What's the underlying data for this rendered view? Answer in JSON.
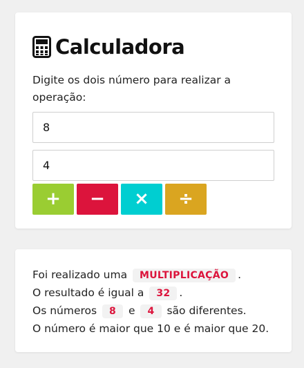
{
  "calculator": {
    "title": "Calculadora",
    "prompt": "Digite os dois número para realizar a operação:",
    "first_value": "8",
    "second_value": "4",
    "buttons": {
      "add": "+",
      "subtract": "−",
      "multiply": "×",
      "divide": "÷"
    },
    "colors": {
      "add": "#9acd32",
      "subtract": "#dc143c",
      "multiply": "#00ced1",
      "divide": "#daa520",
      "highlight": "#dc143c"
    }
  },
  "result": {
    "line1_prefix": "Foi realizado uma",
    "operation": "MULTIPLICAÇÃO",
    "line1_suffix": ".",
    "line2_prefix": "O resultado é igual a",
    "value": "32",
    "line2_suffix": ".",
    "line3_prefix": "Os números",
    "num_a": "8",
    "line3_and": "e",
    "num_b": "4",
    "line3_suffix": "são diferentes.",
    "line4": "O número é maior que 10 e é maior que 20."
  }
}
